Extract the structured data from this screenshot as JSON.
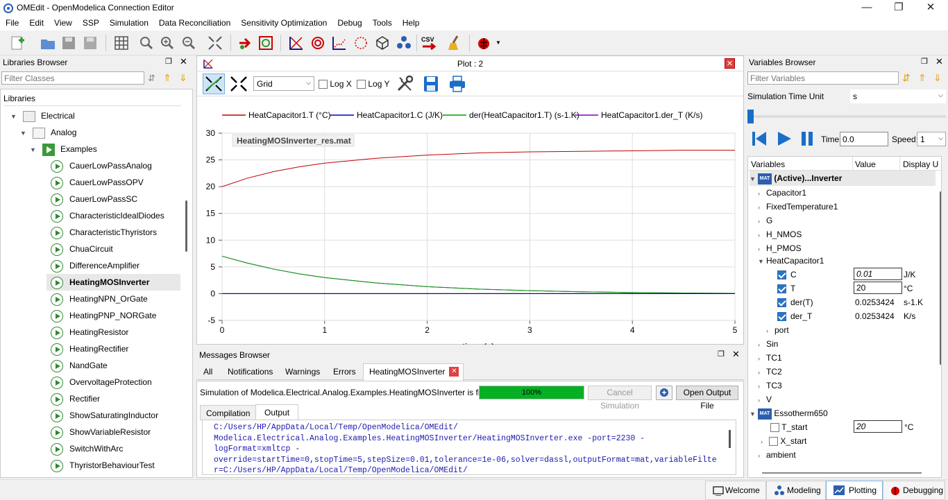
{
  "window": {
    "title": "OMEdit - OpenModelica Connection Editor",
    "min": "—",
    "restore": "❐",
    "close": "✕"
  },
  "menu": [
    "File",
    "Edit",
    "View",
    "SSP",
    "Simulation",
    "Data Reconciliation",
    "Sensitivity Optimization",
    "Debug",
    "Tools",
    "Help"
  ],
  "libraries": {
    "title": "Libraries Browser",
    "filter_placeholder": "Filter Classes",
    "header": "Libraries",
    "electrical": "Electrical",
    "analog": "Analog",
    "examples": "Examples",
    "items": [
      "CauerLowPassAnalog",
      "CauerLowPassOPV",
      "CauerLowPassSC",
      "CharacteristicIdealDiodes",
      "CharacteristicThyristors",
      "ChuaCircuit",
      "DifferenceAmplifier",
      "HeatingMOSInverter",
      "HeatingNPN_OrGate",
      "HeatingPNP_NORGate",
      "HeatingResistor",
      "HeatingRectifier",
      "NandGate",
      "OvervoltageProtection",
      "Rectifier",
      "ShowSaturatingInductor",
      "ShowVariableResistor",
      "SwitchWithArc",
      "ThyristorBehaviourTest"
    ],
    "selected": "HeatingMOSInverter"
  },
  "plot": {
    "title": "Plot : 2",
    "grid_option": "Grid",
    "logx": "Log X",
    "logy": "Log Y",
    "file_label": "HeatingMOSInverter_res.mat",
    "xlabel": "time (s)"
  },
  "chart_data": {
    "type": "line",
    "title": "",
    "xlabel": "time (s)",
    "ylabel": "",
    "xlim": [
      0,
      5
    ],
    "ylim": [
      -5,
      30
    ],
    "xticks": [
      0,
      1,
      2,
      3,
      4,
      5
    ],
    "yticks": [
      -5,
      0,
      5,
      10,
      15,
      20,
      25,
      30
    ],
    "grid": true,
    "legend_position": "top",
    "x": [
      0,
      0.25,
      0.5,
      0.75,
      1,
      1.5,
      2,
      2.5,
      3,
      3.5,
      4,
      4.5,
      5
    ],
    "series": [
      {
        "name": "HeatCapacitor1.T (°C)",
        "color": "#c00000",
        "values": [
          20,
          21.6,
          22.8,
          23.7,
          24.4,
          25.3,
          25.9,
          26.3,
          26.5,
          26.6,
          26.7,
          26.8,
          26.8
        ]
      },
      {
        "name": "HeatCapacitor1.C (J/K)",
        "color": "#0000c0",
        "values": [
          0.01,
          0.01,
          0.01,
          0.01,
          0.01,
          0.01,
          0.01,
          0.01,
          0.01,
          0.01,
          0.01,
          0.01,
          0.01
        ]
      },
      {
        "name": "der(HeatCapacitor1.T) (s-1.K)",
        "color": "#00a000",
        "values": [
          7,
          5.7,
          4.6,
          3.7,
          3.0,
          2.0,
          1.3,
          0.85,
          0.55,
          0.35,
          0.2,
          0.12,
          0.05
        ]
      },
      {
        "name": "HeatCapacitor1.der_T (K/s)",
        "color": "#8000c0",
        "values": [
          7,
          5.7,
          4.6,
          3.7,
          3.0,
          2.0,
          1.3,
          0.85,
          0.55,
          0.35,
          0.2,
          0.12,
          0.05
        ]
      }
    ]
  },
  "messages": {
    "title": "Messages Browser",
    "tabs": [
      "All",
      "Notifications",
      "Warnings",
      "Errors",
      "HeatingMOSInverter"
    ],
    "status": "Simulation of Modelica.Electrical.Analog.Examples.HeatingMOSInverter is finished.",
    "progress": "100%",
    "progress_value": 1.0,
    "cancel": "Cancel Simulation",
    "open_output": "Open Output File",
    "subtabs": [
      "Compilation",
      "Output"
    ],
    "output_lines": [
      "C:/Users/HP/AppData/Local/Temp/OpenModelica/OMEdit/",
      "Modelica.Electrical.Analog.Examples.HeatingMOSInverter/HeatingMOSInverter.exe -port=2230 -",
      "logFormat=xmltcp -",
      "override=startTime=0,stopTime=5,stepSize=0.01,tolerance=1e-06,solver=dassl,outputFormat=mat,variableFilte",
      "r=C:/Users/HP/AppData/Local/Temp/OpenModelica/OMEdit/"
    ]
  },
  "variables": {
    "title": "Variables Browser",
    "filter_placeholder": "Filter Variables",
    "time_unit_label": "Simulation Time Unit",
    "time_unit": "s",
    "time_label": "Time:",
    "time_value": "0.0",
    "speed_label": "Speed:",
    "speed_value": "1",
    "col_variables": "Variables",
    "col_value": "Value",
    "col_unit": "Display U",
    "active": "(Active)...Inverter",
    "nodes1": [
      "Capacitor1",
      "FixedTemperature1",
      "G",
      "H_NMOS",
      "H_PMOS"
    ],
    "heatcap": "HeatCapacitor1",
    "heatcap_vars": [
      {
        "name": "C",
        "value": "0.01",
        "unit": "J/K",
        "editable": true
      },
      {
        "name": "T",
        "value": "20",
        "unit": "°C",
        "editable": true
      },
      {
        "name": "der(T)",
        "value": "0.0253424",
        "unit": "s-1.K",
        "editable": false
      },
      {
        "name": "der_T",
        "value": "0.0253424",
        "unit": "K/s",
        "editable": false
      }
    ],
    "port": "port",
    "nodes2": [
      "Sin",
      "TC1",
      "TC2",
      "TC3",
      "V"
    ],
    "essotherm": "Essotherm650",
    "t_start": "T_start",
    "t_start_value": "20",
    "t_start_unit": "°C",
    "x_start": "X_start",
    "ambient": "ambient"
  },
  "perspectives": [
    "Welcome",
    "Modeling",
    "Plotting",
    "Debugging"
  ],
  "colors": {
    "accent": "#2a74c8",
    "progress": "#06b025"
  }
}
